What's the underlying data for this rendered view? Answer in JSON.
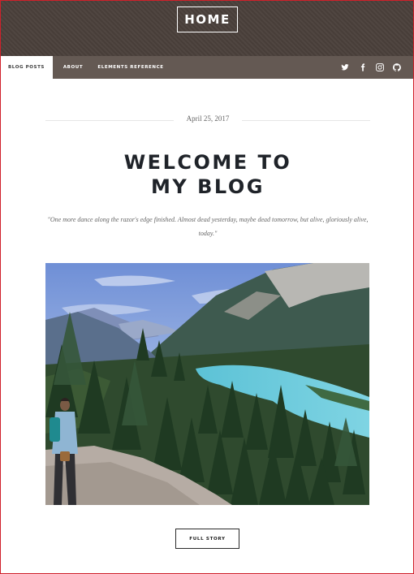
{
  "header": {
    "logo_label": "HOME"
  },
  "nav": {
    "items": [
      {
        "label": "BLOG POSTS",
        "active": true
      },
      {
        "label": "ABOUT",
        "active": false
      },
      {
        "label": "ELEMENTS REFERENCE",
        "active": false
      }
    ],
    "social_icons": [
      "twitter-icon",
      "facebook-icon",
      "instagram-icon",
      "github-icon"
    ]
  },
  "post": {
    "date": "April 25, 2017",
    "title_line1": "WELCOME TO",
    "title_line2": "MY BLOG",
    "quote": "\"One more dance along the razor's edge finished. Almost dead yesterday, maybe dead tomorrow, but alive, gloriously alive, today.\"",
    "cta_label": "FULL STORY"
  },
  "colors": {
    "header_bg": "#4a403b",
    "nav_bg": "#645953",
    "title_color": "#1f2329",
    "frame_border": "#d0202a"
  }
}
